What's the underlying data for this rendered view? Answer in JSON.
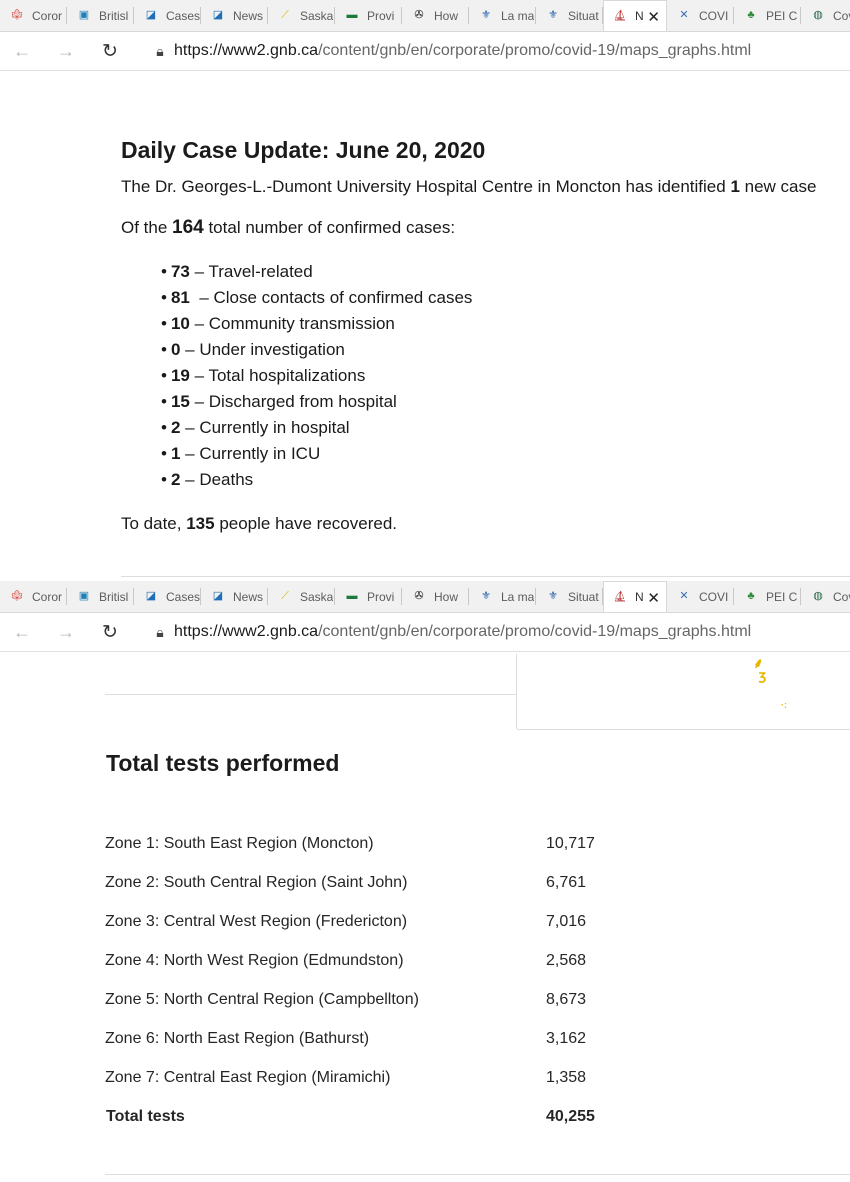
{
  "browser": {
    "tabs": [
      {
        "label": "Coror",
        "icon": "maple-leaf-icon"
      },
      {
        "label": "Britisl",
        "icon": "bc-shield-icon"
      },
      {
        "label": "Cases",
        "icon": "chart-icon"
      },
      {
        "label": "News",
        "icon": "chart-icon"
      },
      {
        "label": "Saska",
        "icon": "wheat-icon"
      },
      {
        "label": "Provi",
        "icon": "flag-icon"
      },
      {
        "label": "How",
        "icon": "trillium-icon"
      },
      {
        "label": "La ma",
        "icon": "fleur-de-lis-icon"
      },
      {
        "label": "Situat",
        "icon": "fleur-de-lis-icon"
      },
      {
        "label": "N",
        "icon": "ship-icon",
        "active": true
      },
      {
        "label": "COVI",
        "icon": "ns-flag-icon"
      },
      {
        "label": "PEI C",
        "icon": "pei-icon"
      },
      {
        "label": "Covic",
        "icon": "globe-icon"
      }
    ],
    "url_host": "https://www2.gnb.ca",
    "url_path": "/content/gnb/en/corporate/promo/covid-19/maps_graphs.html"
  },
  "update": {
    "title": "Daily Case Update: June 20, 2020",
    "intro_pre": "The Dr. Georges-L.-Dumont University Hospital Centre in Moncton has identified ",
    "intro_num": "1",
    "intro_post": " new case",
    "total_pre": "Of the ",
    "total_num": "164",
    "total_post": " total number of confirmed cases:",
    "bullet": "•",
    "stats": [
      {
        "num": "73",
        "label": " – Travel-related"
      },
      {
        "num": "81",
        "label": "  – Close contacts of confirmed cases"
      },
      {
        "num": "10",
        "label": " – Community transmission"
      },
      {
        "num": "0",
        "label": " – Under investigation"
      },
      {
        "num": "19",
        "label": " – Total hospitalizations"
      },
      {
        "num": "15",
        "label": " – Discharged from hospital"
      },
      {
        "num": "2",
        "label": " – Currently in hospital"
      },
      {
        "num": "1",
        "label": " – Currently in ICU"
      },
      {
        "num": "2",
        "label": " – Deaths"
      }
    ],
    "recovered_pre": "To date, ",
    "recovered_num": "135",
    "recovered_post": " people have recovered."
  },
  "tests": {
    "title": "Total tests performed",
    "rows": [
      {
        "zone": "Zone 1: South East Region (Moncton)",
        "count": "10,717"
      },
      {
        "zone": "Zone 2: South Central Region (Saint John)",
        "count": "6,761"
      },
      {
        "zone": "Zone 3: Central West Region (Fredericton)",
        "count": "7,016"
      },
      {
        "zone": "Zone 4: North West Region (Edmundston)",
        "count": "2,568"
      },
      {
        "zone": "Zone 5: North Central Region (Campbellton)",
        "count": "8,673"
      },
      {
        "zone": "Zone 6: North East Region (Bathurst)",
        "count": "3,162"
      },
      {
        "zone": "Zone 7: Central East Region (Miramichi)",
        "count": "1,358"
      }
    ],
    "total_label": "Total tests",
    "total_value": "40,255"
  },
  "colors": {
    "map_marker": "#e8b400"
  }
}
